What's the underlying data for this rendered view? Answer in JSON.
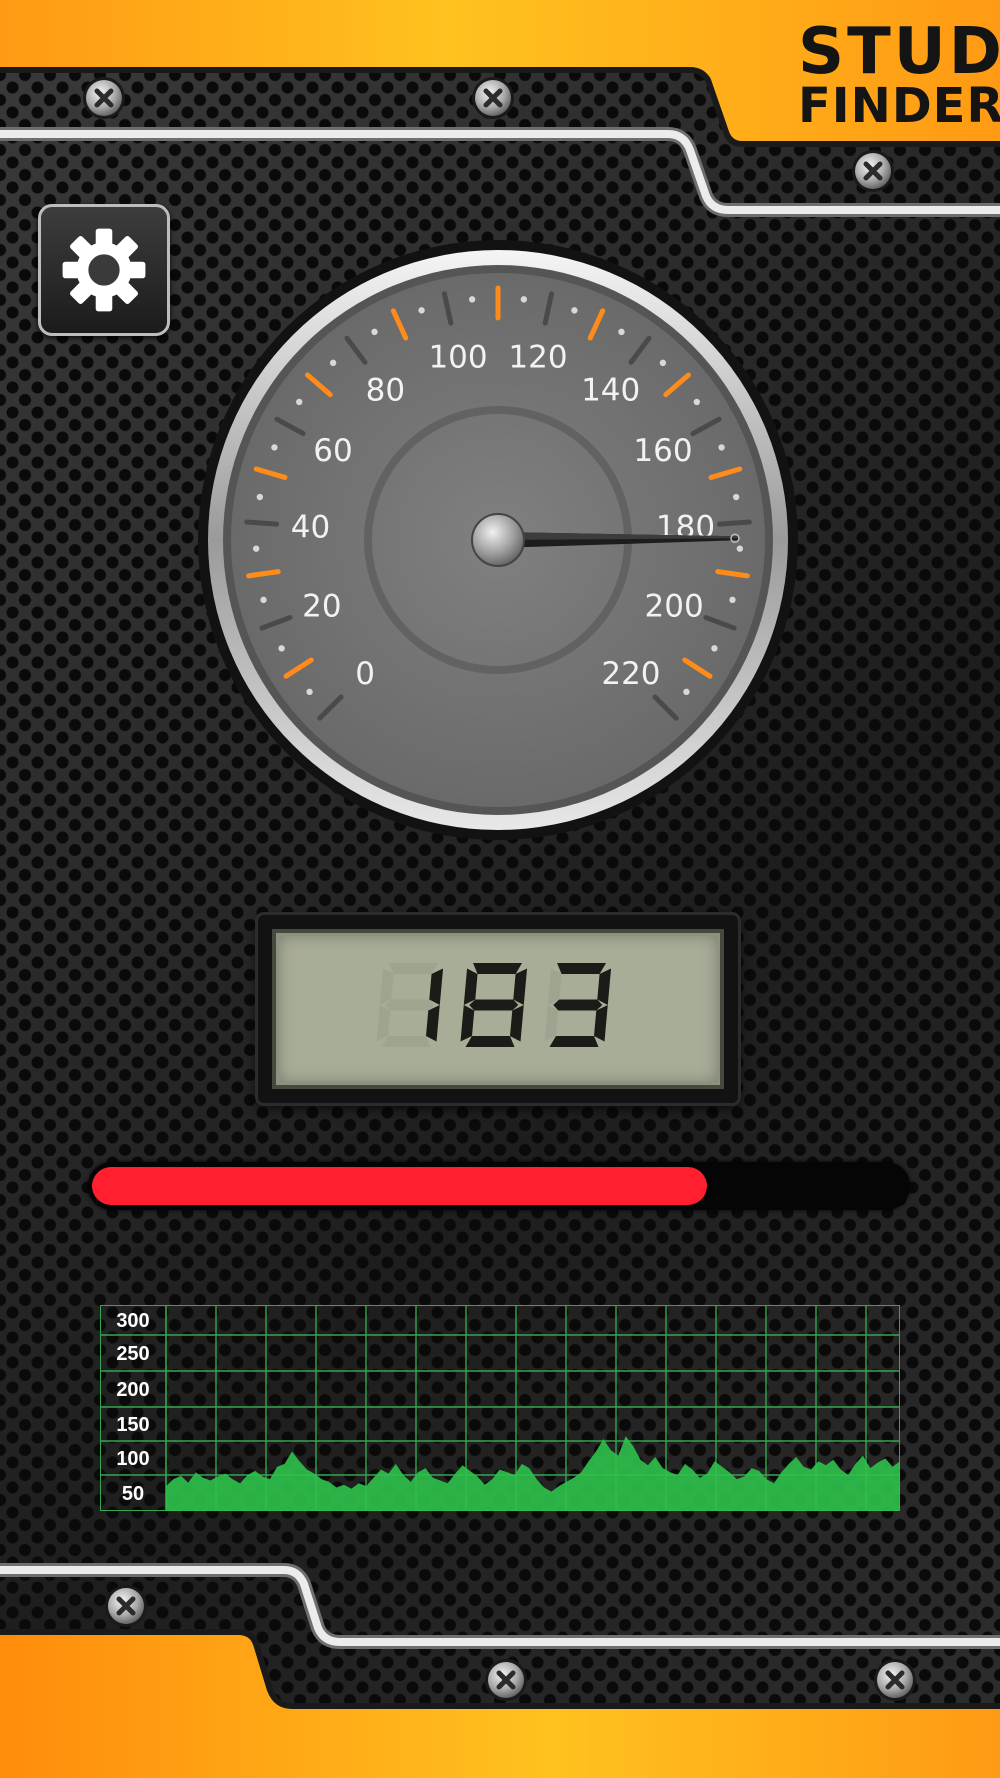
{
  "app": {
    "logo_line1": "STUD",
    "logo_line2": "FINDER",
    "accent_color": "#ffa51f",
    "settings_icon": "gear-icon"
  },
  "gauge": {
    "min": 0,
    "max": 220,
    "tick_labels": [
      "0",
      "20",
      "40",
      "60",
      "80",
      "100",
      "120",
      "140",
      "160",
      "180",
      "200",
      "220"
    ],
    "needle_value": 183,
    "accent_tick_color": "#ff8c1a"
  },
  "readout": {
    "value": "183"
  },
  "level_bar": {
    "fraction": 0.755,
    "color": "#ff1f2e"
  },
  "history_graph": {
    "y_labels": [
      "300",
      "250",
      "200",
      "150",
      "100",
      "50"
    ],
    "y_max": 300,
    "color": "#2ec24a",
    "values": [
      60,
      70,
      75,
      65,
      80,
      72,
      68,
      74,
      78,
      70,
      64,
      76,
      82,
      74,
      70,
      88,
      92,
      110,
      96,
      84,
      78,
      70,
      66,
      58,
      62,
      56,
      64,
      60,
      72,
      84,
      78,
      92,
      76,
      66,
      80,
      86,
      72,
      68,
      64,
      78,
      90,
      82,
      74,
      62,
      70,
      84,
      80,
      76,
      92,
      86,
      70,
      58,
      52,
      60,
      66,
      72,
      80,
      96,
      110,
      128,
      112,
      104,
      132,
      118,
      98,
      90,
      102,
      86,
      80,
      76,
      92,
      84,
      72,
      78,
      96,
      88,
      80,
      70,
      74,
      86,
      82,
      70,
      64,
      80,
      92,
      102,
      88,
      84,
      96,
      90,
      98,
      84,
      76,
      92,
      104,
      86,
      94,
      100,
      88,
      96
    ]
  }
}
